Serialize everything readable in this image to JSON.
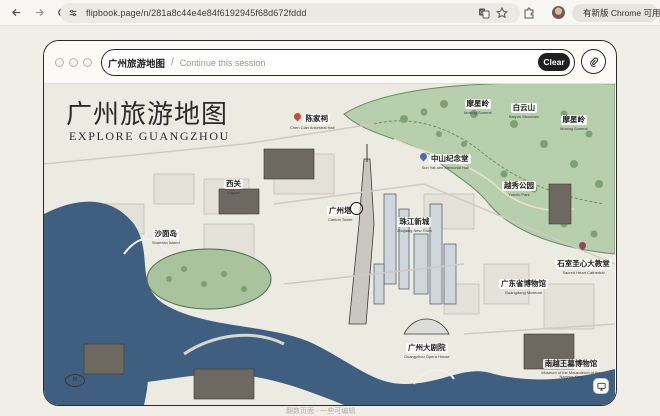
{
  "browser": {
    "url": "flipbook.page/n/281a8c44e4e84f6192945f68d672fddd",
    "update_label": "有新版 Chrome 可用"
  },
  "app": {
    "session_title": "广州旅游地图",
    "separator": "/",
    "session_placeholder": "Continue this session",
    "clear_label": "Clear",
    "footer_text": "翻数页面 · 一些可编辑"
  },
  "map": {
    "title_cn": "广州旅游地图",
    "title_en": "EXPLORE GUANGZHOU",
    "compass": "N",
    "landmarks": [
      {
        "id": "chen",
        "cn": "陈家祠",
        "en": "Chen Clan Ancestral Hall",
        "pin_color": "#c0503c"
      },
      {
        "id": "sun",
        "cn": "中山纪念堂",
        "en": "Sun Yat-sen Memorial Hall",
        "pin_color": "#4a6ea8"
      },
      {
        "id": "moxing",
        "cn": "摩星岭",
        "en": "Moxing Summit",
        "pin_color": "#3d7a52"
      },
      {
        "id": "baiyun",
        "cn": "白云山",
        "en": "Baiyun Mountain",
        "pin_color": "#3d7a52"
      },
      {
        "id": "moxing2",
        "cn": "摩星岭",
        "en": "Moxing Summit",
        "pin_color": "#3d7a52"
      },
      {
        "id": "xiguan",
        "cn": "西关",
        "en": "Xiguan",
        "pin_color": "#8a6d3b"
      },
      {
        "id": "yuexiu",
        "cn": "越秀公园",
        "en": "Yuexiu Park",
        "pin_color": "#3d7a52"
      },
      {
        "id": "tower",
        "cn": "广州塔",
        "en": "Canton Tower",
        "pin_color": "#4a6ea8"
      },
      {
        "id": "zhujiang",
        "cn": "珠江新城",
        "en": "Zhujiang New Town",
        "pin_color": "#4a6ea8"
      },
      {
        "id": "shamian",
        "cn": "沙面岛",
        "en": "Shamian Island",
        "pin_color": "#3d7a52"
      },
      {
        "id": "cathedral",
        "cn": "石室圣心大教堂",
        "en": "Sacred Heart Cathedral",
        "pin_color": "#8a4b5a"
      },
      {
        "id": "museum",
        "cn": "广东省博物馆",
        "en": "Guangdong Museum",
        "pin_color": "#8a6d3b"
      },
      {
        "id": "opera",
        "cn": "广州大剧院",
        "en": "Guangzhou Opera House",
        "pin_color": "#4a6ea8"
      },
      {
        "id": "nanyue",
        "cn": "南越王墓博物馆",
        "en": "Museum of the Mausoleum of the Nanyue King",
        "pin_color": "#8a6d3b"
      }
    ]
  },
  "icons": {
    "back": "arrow-left-icon",
    "forward": "arrow-right-icon",
    "reload": "reload-icon",
    "site": "site-settings-icon",
    "translate": "translate-icon",
    "star": "bookmark-star-icon",
    "extensions": "puzzle-icon",
    "attach": "paperclip-icon",
    "corner": "screen-icon"
  },
  "colors": {
    "river": "#3f5f80",
    "park": "#c9d8bf",
    "ink": "#2a2a2a"
  }
}
